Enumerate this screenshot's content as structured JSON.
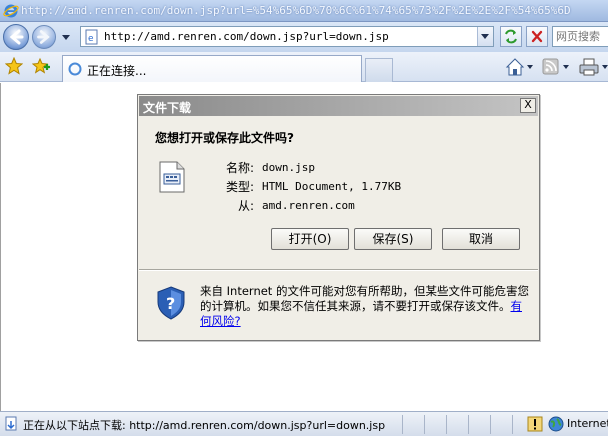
{
  "window": {
    "title": "http://amd.renren.com/down.jsp?url=%54%65%6D%70%6C%61%74%65%73%2F%2E%2E%2F%54%65%6D"
  },
  "address": {
    "url": "http://amd.renren.com/down.jsp?url=down.jsp"
  },
  "search": {
    "placeholder": "网页搜索"
  },
  "tab": {
    "label": "正在连接..."
  },
  "dialog": {
    "title": "文件下载",
    "close_label": "X",
    "question": "您想打开或保存此文件吗?",
    "name_label": "名称:",
    "name_value": "down.jsp",
    "type_label": "类型:",
    "type_value": "HTML Document, 1.77KB",
    "from_label": "从:",
    "from_value": "amd.renren.com",
    "open_label": "打开(O)",
    "save_label": "保存(S)",
    "cancel_label": "取消",
    "warning_text": "来自 Internet 的文件可能对您有所帮助，但某些文件可能危害您的计算机。如果您不信任其来源，请不要打开或保存该文件。",
    "warning_link": "有何风险?"
  },
  "status": {
    "text": "正在从以下站点下载: http://amd.renren.com/down.jsp?url=down.jsp",
    "zone": "Internet"
  },
  "colors": {
    "dialog_bg": "#f0eee7",
    "link": "#0000ee",
    "dialog_title_bg": "#8a8a8a"
  }
}
